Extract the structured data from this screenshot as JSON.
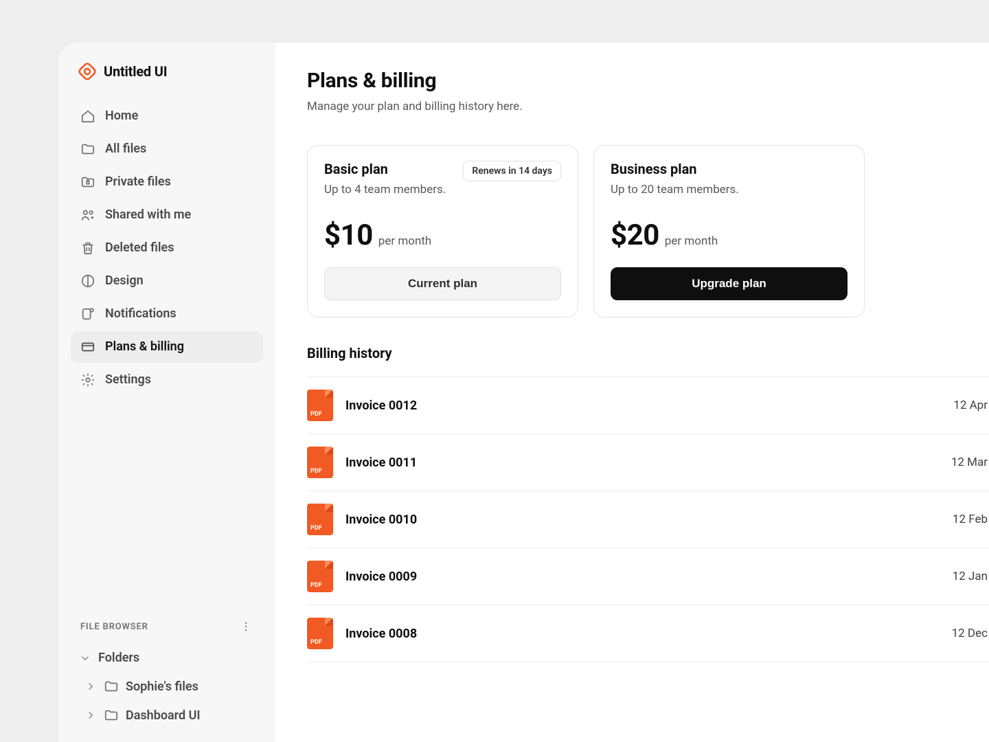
{
  "brand": {
    "name": "Untitled UI"
  },
  "sidebar": {
    "items": [
      {
        "label": "Home",
        "icon": "home-icon"
      },
      {
        "label": "All files",
        "icon": "folder-icon"
      },
      {
        "label": "Private files",
        "icon": "lock-folder-icon"
      },
      {
        "label": "Shared with me",
        "icon": "share-icon"
      },
      {
        "label": "Deleted files",
        "icon": "trash-icon"
      },
      {
        "label": "Design",
        "icon": "design-icon"
      },
      {
        "label": "Notifications",
        "icon": "bell-icon"
      },
      {
        "label": "Plans & billing",
        "icon": "card-icon",
        "active": true
      },
      {
        "label": "Settings",
        "icon": "gear-icon"
      }
    ],
    "browser": {
      "title": "FILE BROWSER",
      "root": "Folders",
      "children": [
        {
          "label": "Sophie's files"
        },
        {
          "label": "Dashboard UI"
        }
      ]
    }
  },
  "page": {
    "title": "Plans & billing",
    "subtitle": "Manage your plan and billing history here."
  },
  "plans": [
    {
      "name": "Basic plan",
      "description": "Up to 4 team members.",
      "price": "$10",
      "period": "per month",
      "badge": "Renews in 14 days",
      "button_label": "Current plan",
      "button_kind": "current"
    },
    {
      "name": "Business plan",
      "description": "Up to 20 team members.",
      "price": "$20",
      "period": "per month",
      "button_label": "Upgrade plan",
      "button_kind": "upgrade"
    }
  ],
  "billing_history": {
    "title": "Billing history",
    "invoices": [
      {
        "name": "Invoice 0012",
        "date": "12 Apr"
      },
      {
        "name": "Invoice 0011",
        "date": "12 Mar"
      },
      {
        "name": "Invoice 0010",
        "date": "12 Feb"
      },
      {
        "name": "Invoice 0009",
        "date": "12 Jan"
      },
      {
        "name": "Invoice 0008",
        "date": "12 Dec"
      }
    ]
  }
}
